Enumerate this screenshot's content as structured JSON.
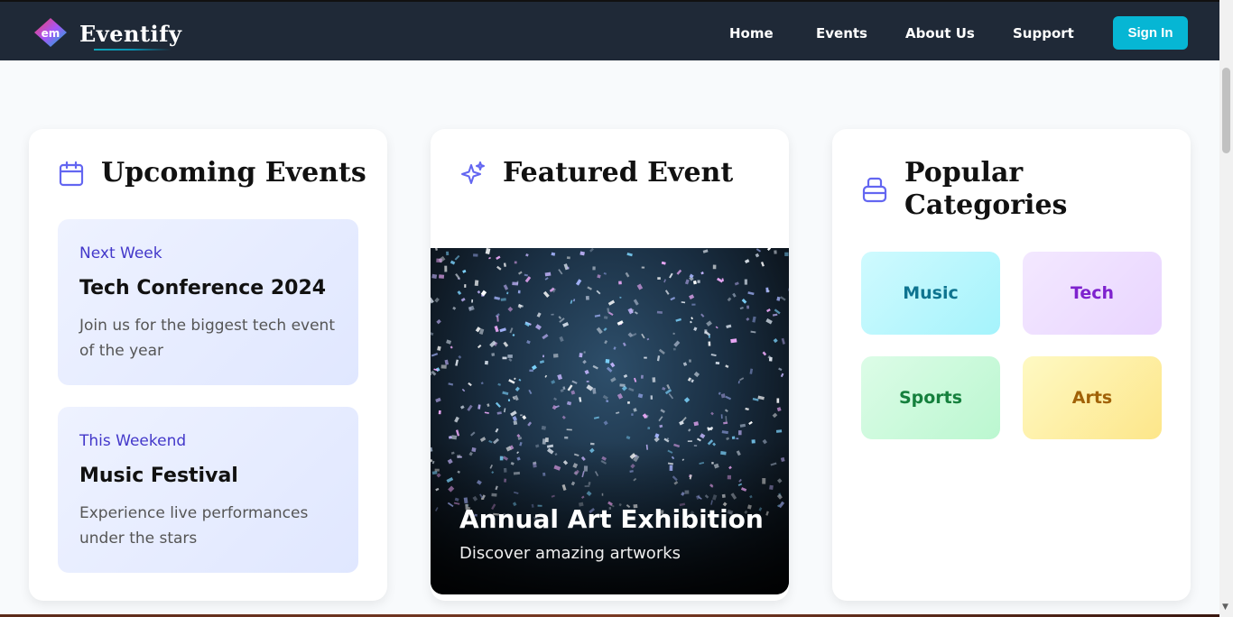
{
  "nav": {
    "brand": "Eventify",
    "logo_text": "em",
    "links": [
      "Home",
      "Events",
      "About Us",
      "Support"
    ],
    "signin_label": "Sign In"
  },
  "upcoming": {
    "title": "Upcoming Events",
    "events": [
      {
        "when": "Next Week",
        "name": "Tech Conference 2024",
        "desc": "Join us for the biggest tech event of the year"
      },
      {
        "when": "This Weekend",
        "name": "Music Festival",
        "desc": "Experience live performances under the stars"
      }
    ]
  },
  "featured": {
    "title": "Featured Event",
    "name": "Annual Art Exhibition",
    "desc": "Discover amazing artworks"
  },
  "categories": {
    "title": "Popular Categories",
    "items": [
      {
        "label": "Music",
        "color": "#0e7490"
      },
      {
        "label": "Tech",
        "color": "#7e22ce"
      },
      {
        "label": "Sports",
        "color": "#15803d"
      },
      {
        "label": "Arts",
        "color": "#a16207"
      }
    ]
  },
  "colors": {
    "nav_bg": "#1f2937",
    "accent": "#06b6d4",
    "icon": "#6366f1"
  }
}
